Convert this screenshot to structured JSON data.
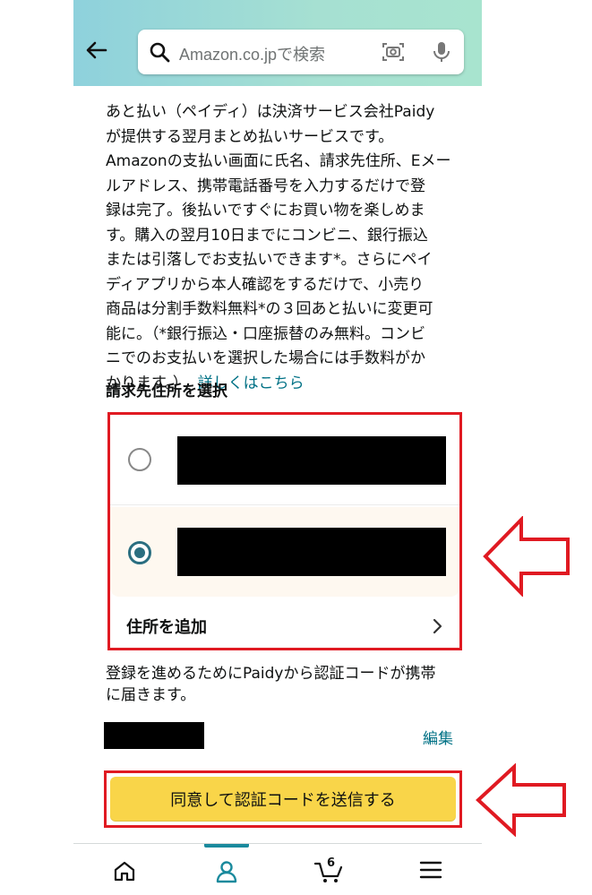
{
  "header": {
    "search_placeholder": "Amazon.co.jpで検索"
  },
  "description": {
    "text": "あと払い（ペイディ）は決済サービス会社Paidy\nが提供する翌月まとめ払いサービスです。\nAmazonの支払い画面に氏名、請求先住所、Eメー\nルアドレス、携帯電話番号を入力するだけで登\n録は完了。後払いですぐにお買い物を楽しめま\nす。購入の翌月10日までにコンビニ、銀行振込\nまたは引落しでお支払いできます*。さらにペイ\nディアプリから本人確認をするだけで、小売り\n商品は分割手数料無料*の３回あと払いに変更可\n能に。（*銀行振込・口座振替のみ無料。コンビ\nニでのお支払いを選択した場合には手数料がか\nかります。）",
    "link": "詳しくはこちら"
  },
  "address_section": {
    "title": "請求先住所を選択",
    "options": [
      {
        "selected": false
      },
      {
        "selected": true
      }
    ],
    "add_address": "住所を追加"
  },
  "verification": {
    "notice": "登録を進めるためにPaidyから認証コードが携帯\nに届きます。",
    "edit_label": "編集",
    "submit_button": "同意して認証コードを送信する"
  },
  "bottom_nav": {
    "cart_count": "6"
  },
  "colors": {
    "header_gradient_start": "#8ed1dc",
    "header_gradient_end": "#a8e4cf",
    "cta_yellow": "#f9d549",
    "link_teal": "#007185",
    "highlight_red": "#e01a22"
  }
}
